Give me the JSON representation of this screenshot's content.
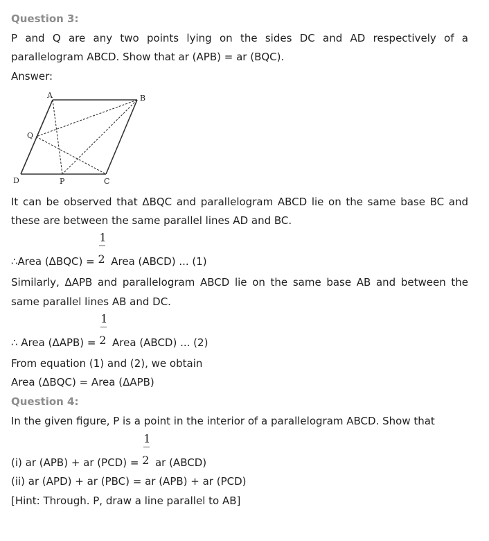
{
  "question3": {
    "title": "Question 3:",
    "statement_line1": "P and Q are any two points lying on the sides DC and AD respectively of a",
    "statement_line2": "parallelogram ABCD. Show that ar (APB) = ar (BQC).",
    "answer_label": "Answer:",
    "figure": {
      "labels": {
        "A": "A",
        "B": "B",
        "C": "C",
        "D": "D",
        "P": "P",
        "Q": "Q"
      }
    },
    "solution": {
      "line1": "It can be observed that ΔBQC and parallelogram ABCD lie on the same base BC and",
      "line2": "these are between the same parallel lines AD and BC.",
      "eq1_left": "∴Area (ΔBQC) = ",
      "eq1_frac_num": "1",
      "eq1_frac_den": "2",
      "eq1_right": " Area (ABCD) ... (1)",
      "line3": "Similarly, ΔAPB and parallelogram ABCD lie on the same base AB and between the",
      "line4": "same parallel lines AB and DC.",
      "eq2_left": "∴ Area (ΔAPB) = ",
      "eq2_frac_num": "1",
      "eq2_frac_den": "2",
      "eq2_right": " Area (ABCD) ... (2)",
      "line5": "From equation (1) and (2), we obtain",
      "line6": "Area (ΔBQC) = Area (ΔAPB)"
    }
  },
  "question4": {
    "title": "Question 4:",
    "statement": "In the given figure, P is a point in the interior of a parallelogram ABCD. Show that",
    "part1_left": "(i) ar (APB) + ar (PCD) = ",
    "part1_frac_num": "1",
    "part1_frac_den": "2",
    "part1_right": " ar (ABCD)",
    "part2": "(ii) ar (APD) + ar (PBC) = ar (APB) + ar (PCD)",
    "hint": "[Hint: Through. P, draw a line parallel to AB]"
  }
}
